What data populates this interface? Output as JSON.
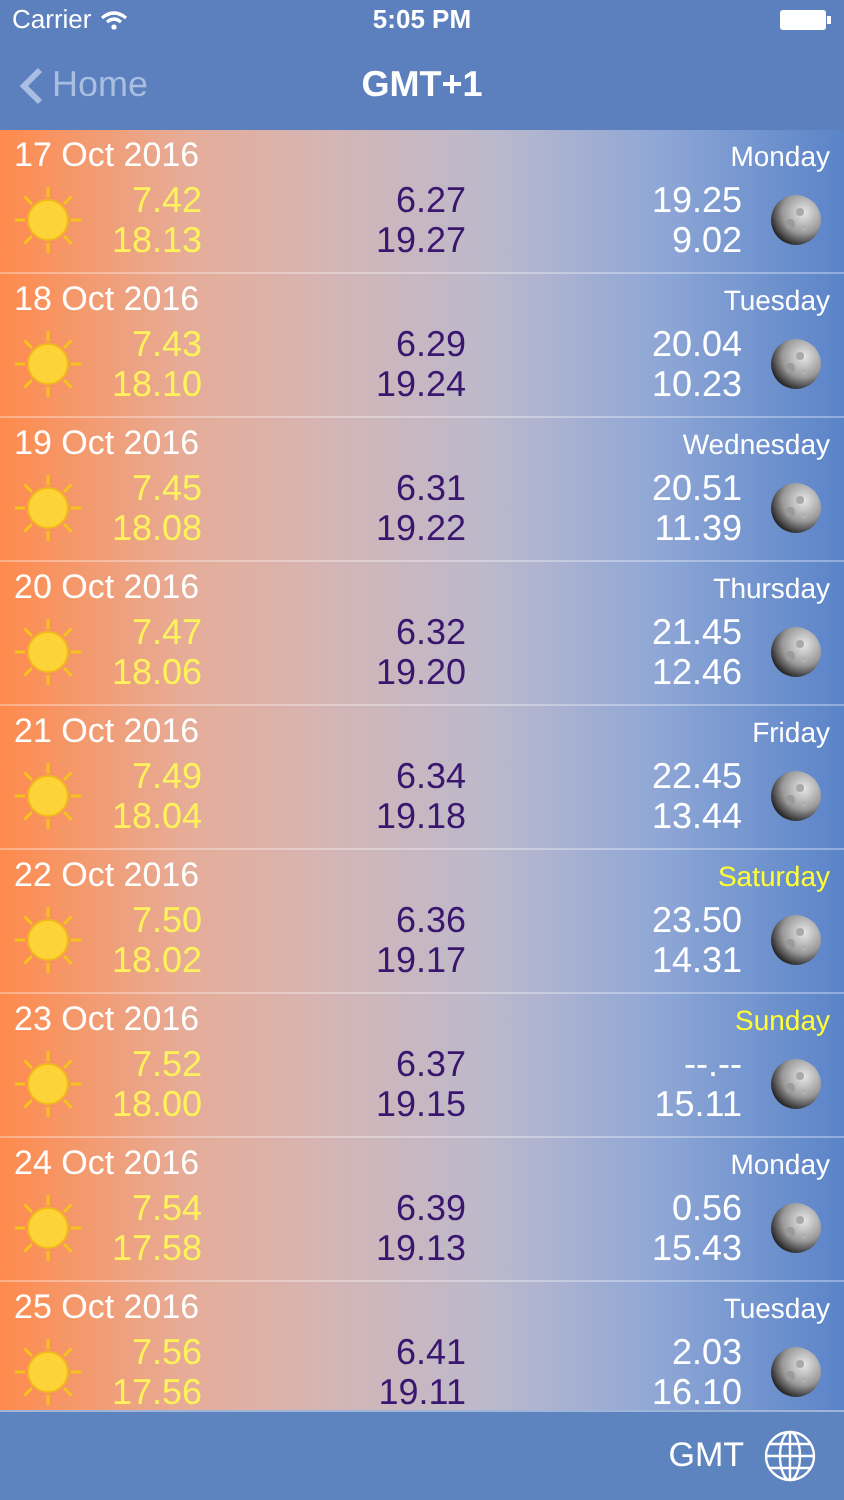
{
  "status_bar": {
    "carrier": "Carrier",
    "time": "5:05 PM"
  },
  "nav": {
    "back": "Home",
    "title": "GMT+1"
  },
  "days": [
    {
      "date": "17 Oct 2016",
      "weekday": "Monday",
      "weekend": false,
      "sunrise": "7.42",
      "sunset": "18.13",
      "twilight_1": "6.27",
      "twilight_2": "19.27",
      "moonrise": "19.25",
      "moonset": "9.02"
    },
    {
      "date": "18 Oct 2016",
      "weekday": "Tuesday",
      "weekend": false,
      "sunrise": "7.43",
      "sunset": "18.10",
      "twilight_1": "6.29",
      "twilight_2": "19.24",
      "moonrise": "20.04",
      "moonset": "10.23"
    },
    {
      "date": "19 Oct 2016",
      "weekday": "Wednesday",
      "weekend": false,
      "sunrise": "7.45",
      "sunset": "18.08",
      "twilight_1": "6.31",
      "twilight_2": "19.22",
      "moonrise": "20.51",
      "moonset": "11.39"
    },
    {
      "date": "20 Oct 2016",
      "weekday": "Thursday",
      "weekend": false,
      "sunrise": "7.47",
      "sunset": "18.06",
      "twilight_1": "6.32",
      "twilight_2": "19.20",
      "moonrise": "21.45",
      "moonset": "12.46"
    },
    {
      "date": "21 Oct 2016",
      "weekday": "Friday",
      "weekend": false,
      "sunrise": "7.49",
      "sunset": "18.04",
      "twilight_1": "6.34",
      "twilight_2": "19.18",
      "moonrise": "22.45",
      "moonset": "13.44"
    },
    {
      "date": "22 Oct 2016",
      "weekday": "Saturday",
      "weekend": true,
      "sunrise": "7.50",
      "sunset": "18.02",
      "twilight_1": "6.36",
      "twilight_2": "19.17",
      "moonrise": "23.50",
      "moonset": "14.31"
    },
    {
      "date": "23 Oct 2016",
      "weekday": "Sunday",
      "weekend": true,
      "sunrise": "7.52",
      "sunset": "18.00",
      "twilight_1": "6.37",
      "twilight_2": "19.15",
      "moonrise": "--.--",
      "moonset": "15.11"
    },
    {
      "date": "24 Oct 2016",
      "weekday": "Monday",
      "weekend": false,
      "sunrise": "7.54",
      "sunset": "17.58",
      "twilight_1": "6.39",
      "twilight_2": "19.13",
      "moonrise": "0.56",
      "moonset": "15.43"
    },
    {
      "date": "25 Oct 2016",
      "weekday": "Tuesday",
      "weekend": false,
      "sunrise": "7.56",
      "sunset": "17.56",
      "twilight_1": "6.41",
      "twilight_2": "19.11",
      "moonrise": "2.03",
      "moonset": "16.10"
    }
  ],
  "toolbar": {
    "timezone": "GMT"
  }
}
